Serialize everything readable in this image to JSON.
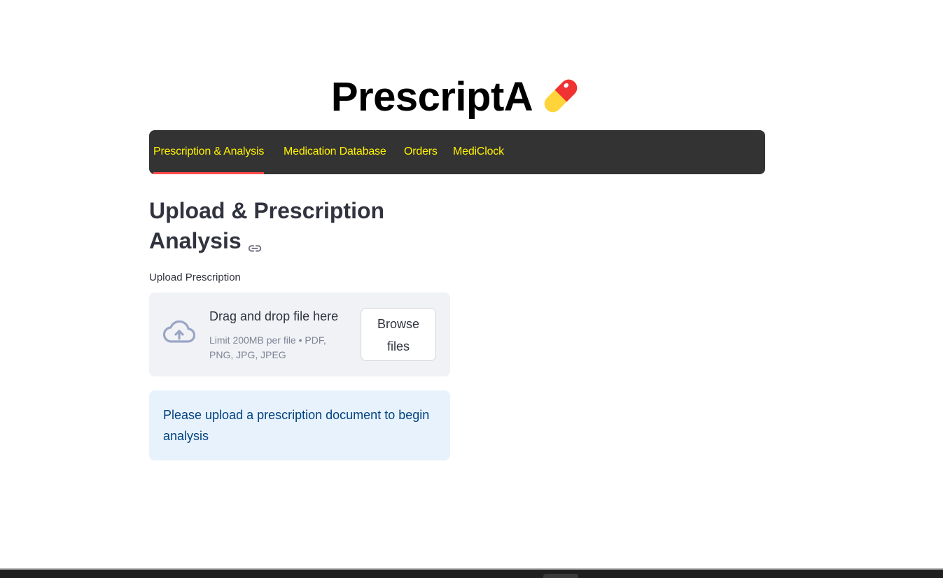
{
  "app": {
    "title": "PrescriptA",
    "title_icon": "pill-icon"
  },
  "nav": {
    "tabs": [
      {
        "label": "Prescription & Analysis",
        "active": true
      },
      {
        "label": "Medication Database",
        "active": false
      },
      {
        "label": "Orders",
        "active": false
      },
      {
        "label": "MediClock",
        "active": false
      }
    ]
  },
  "main": {
    "heading_line1": "Upload & Prescription",
    "heading_line2": "Analysis",
    "heading_icon": "link-icon",
    "upload": {
      "label": "Upload Prescription",
      "dropzone_title": "Drag and drop file here",
      "dropzone_limit": "Limit 200MB per file • PDF, PNG, JPG, JPEG",
      "browse_line1": "Browse",
      "browse_line2": "files",
      "icon": "cloud-upload-icon"
    },
    "info_message": "Please upload a prescription document to begin analysis"
  },
  "colors": {
    "nav_background": "#333333",
    "nav_text": "#fff200",
    "active_tab_indicator": "#ff4b4b",
    "dropzone_background": "#f0f2f6",
    "info_background": "#e8f2fc",
    "info_text": "#004280"
  }
}
